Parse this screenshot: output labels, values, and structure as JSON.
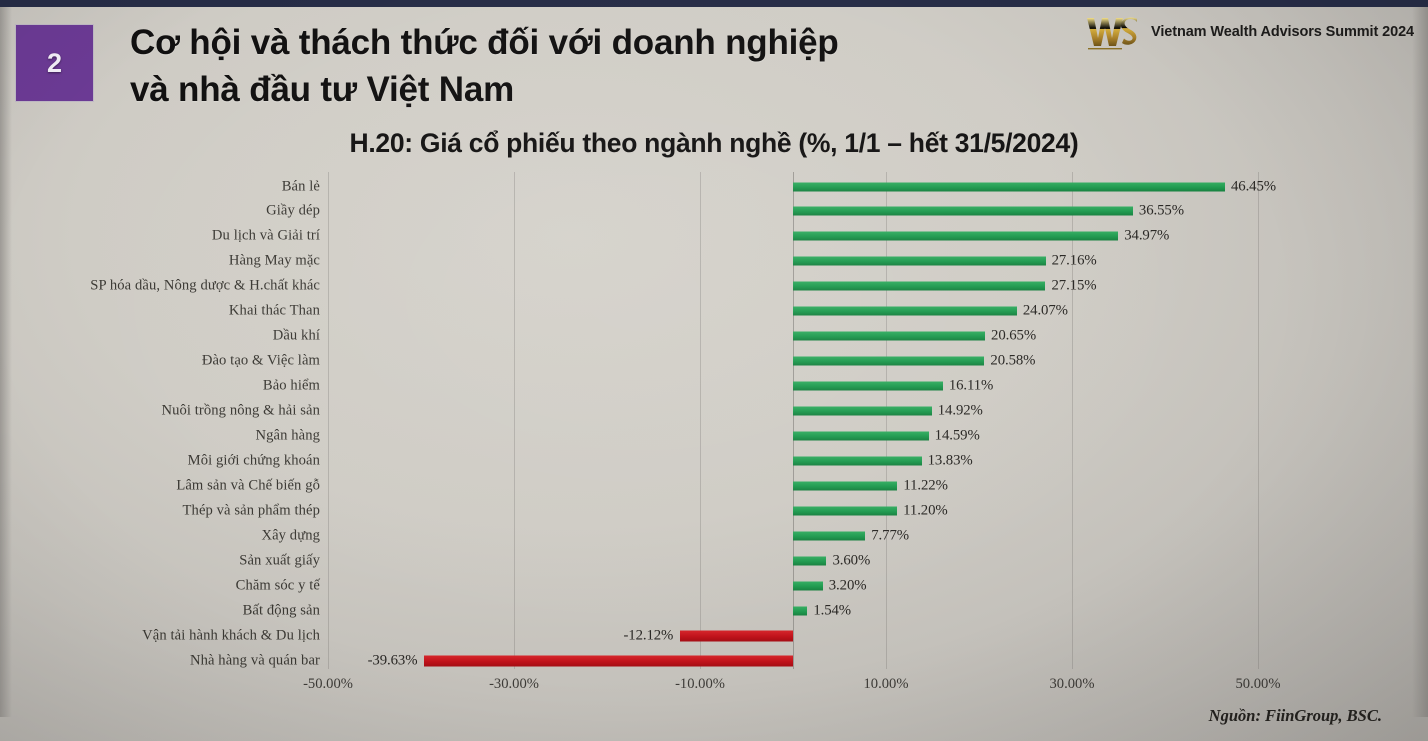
{
  "slide": {
    "badge_number": "2",
    "headline_line1": "Cơ hội và thách thức đối với doanh nghiệp",
    "headline_line2": "và nhà đầu tư Việt Nam",
    "accent_purple": "#6b3a94",
    "topbar_color": "#262c46",
    "background_color": "#cfccc5"
  },
  "brand": {
    "logo_name": "was-logo",
    "logo_text": "WAS",
    "title": "Vietnam Wealth Advisors Summit 2024",
    "gold_color": "#c9a227"
  },
  "source": {
    "text": "Nguồn: FiinGroup, BSC."
  },
  "chart_data": {
    "type": "bar",
    "orientation": "horizontal",
    "title": "H.20: Giá cổ phiếu theo ngành nghề (%, 1/1 – hết 31/5/2024)",
    "xlabel": "",
    "ylabel": "",
    "xlim": [
      -60,
      60
    ],
    "xticks": [
      -50,
      -30,
      -10,
      10,
      30,
      50
    ],
    "xtick_labels": [
      "-50.00%",
      "-30.00%",
      "-10.00%",
      "10.00%",
      "30.00%",
      "50.00%"
    ],
    "grid": true,
    "legend": "none",
    "positive_color": "#1f9a4f",
    "negative_color": "#c0121a",
    "categories": [
      "Bán lẻ",
      "Giầy dép",
      "Du lịch và Giải trí",
      "Hàng May mặc",
      "SP hóa dầu, Nông dược & H.chất khác",
      "Khai thác Than",
      "Dầu khí",
      "Đào tạo & Việc làm",
      "Bảo hiểm",
      "Nuôi trồng nông & hải sản",
      "Ngân hàng",
      "Môi giới chứng khoán",
      "Lâm sản và Chế biến gỗ",
      "Thép và sản phẩm thép",
      "Xây dựng",
      "Sản xuất giấy",
      "Chăm sóc y tế",
      "Bất động sản",
      "Vận tải hành khách & Du lịch",
      "Nhà hàng và quán bar"
    ],
    "values": [
      46.45,
      36.55,
      34.97,
      27.16,
      27.15,
      24.07,
      20.65,
      20.58,
      16.11,
      14.92,
      14.59,
      13.83,
      11.22,
      11.2,
      7.77,
      3.6,
      3.2,
      1.54,
      -12.12,
      -39.63
    ],
    "value_labels": [
      "46.45%",
      "36.55%",
      "34.97%",
      "27.16%",
      "27.15%",
      "24.07%",
      "20.65%",
      "20.58%",
      "16.11%",
      "14.92%",
      "14.59%",
      "13.83%",
      "11.22%",
      "11.20%",
      "7.77%",
      "3.60%",
      "3.20%",
      "1.54%",
      "-12.12%",
      "-39.63%"
    ]
  }
}
